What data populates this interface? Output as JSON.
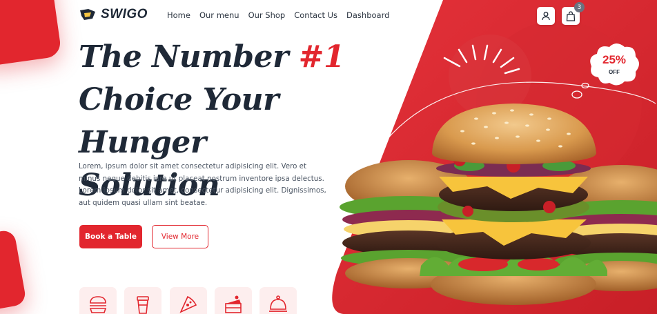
{
  "brand": {
    "name": "SWIGO",
    "accent_color": "#e2262e",
    "dark_color": "#1f2937"
  },
  "nav": {
    "items": [
      {
        "label": "Home"
      },
      {
        "label": "Our menu"
      },
      {
        "label": "Our Shop"
      },
      {
        "label": "Contact Us"
      },
      {
        "label": "Dashboard"
      }
    ]
  },
  "header_actions": {
    "user_icon": "user-icon",
    "cart_icon": "shopping-bag-icon",
    "cart_count": "3"
  },
  "hero": {
    "title_line1_prefix": "The Number ",
    "title_accent": "#1",
    "title_line2": "Choice Your Hunger",
    "title_line3": "Solution",
    "description": "Lorem, ipsum dolor sit amet consectetur adipisicing elit. Vero et minus neque debitis iure ut placeat nostrum inventore ipsa delectus. Lorem ipsum dolor sit amet, consectetur adipisicing elit. Dignissimos, aut quidem quasi ullam sint beatae.",
    "primary_button": "Book a Table",
    "secondary_button": "View More"
  },
  "discount": {
    "percent": "25%",
    "label": "OFF"
  },
  "categories": [
    {
      "icon": "burger-icon"
    },
    {
      "icon": "drink-cup-icon"
    },
    {
      "icon": "pizza-slice-icon"
    },
    {
      "icon": "cake-icon"
    },
    {
      "icon": "food-cloche-icon"
    }
  ]
}
